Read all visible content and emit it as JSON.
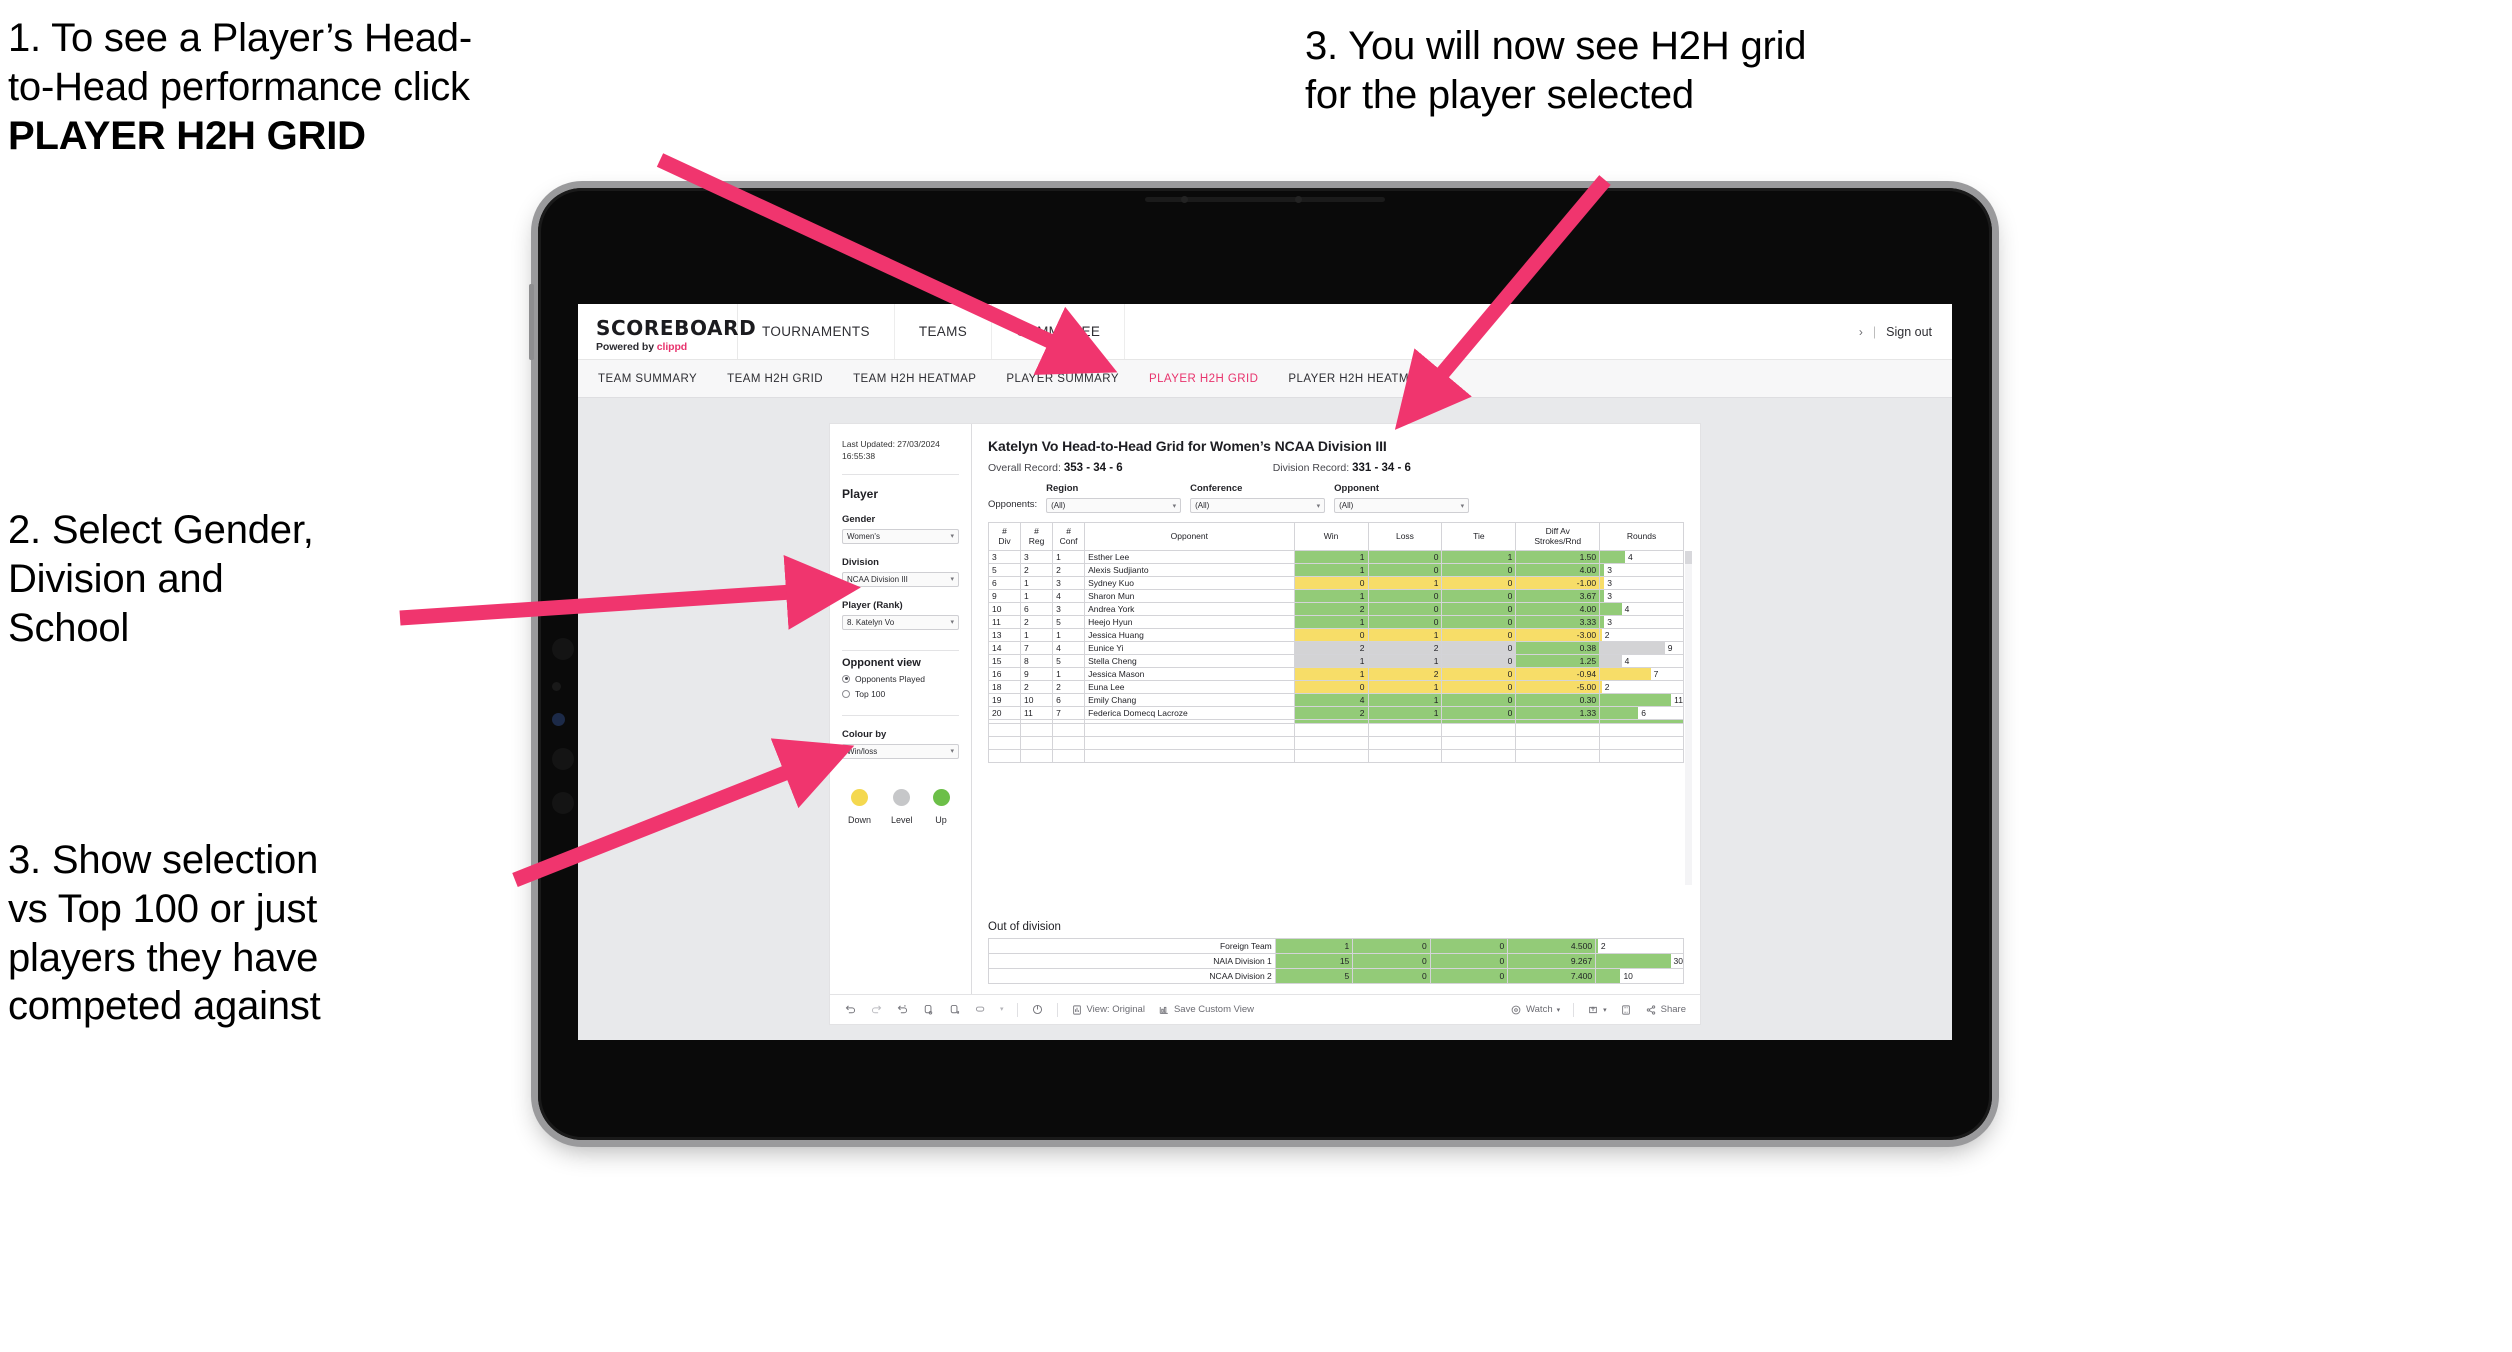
{
  "annotations": [
    {
      "id": "anno1",
      "line1": "1. To see a Player’s Head-",
      "line2": "to-Head performance click",
      "line3": "PLAYER H2H GRID"
    },
    {
      "id": "anno2",
      "text": "2. Select Gender,\nDivision and\nSchool"
    },
    {
      "id": "anno3",
      "text": "3. Show selection\nvs Top 100 or just\nplayers they have\ncompeted against"
    },
    {
      "id": "anno4",
      "text": "3. You will now see H2H grid\nfor the player selected"
    }
  ],
  "accent": {
    "pink": "#e8336d",
    "arrow": "#f0356e",
    "green": "#93cb78",
    "yellow": "#f7dd68",
    "grey": "#d3d3d5"
  },
  "app": {
    "brand": {
      "name": "SCOREBOARD",
      "powered_prefix": "Powered by ",
      "powered_brand": "clippd"
    },
    "mainnav": [
      {
        "label": "TOURNAMENTS"
      },
      {
        "label": "TEAMS"
      },
      {
        "label": "COMMITTEE"
      }
    ],
    "account": {
      "chevron": "›",
      "divider": "|",
      "signout": "Sign out"
    },
    "subnav": [
      {
        "label": "TEAM SUMMARY",
        "active": false
      },
      {
        "label": "TEAM H2H GRID",
        "active": false
      },
      {
        "label": "TEAM H2H HEATMAP",
        "active": false
      },
      {
        "label": "PLAYER SUMMARY",
        "active": false
      },
      {
        "label": "PLAYER H2H GRID",
        "active": true
      },
      {
        "label": "PLAYER H2H HEATMAP",
        "active": false
      }
    ]
  },
  "panel": {
    "last_updated": "Last Updated: 27/03/2024 16:55:38",
    "player_heading": "Player",
    "gender": {
      "label": "Gender",
      "value": "Women's"
    },
    "division": {
      "label": "Division",
      "value": "NCAA Division III"
    },
    "player_rank": {
      "label": "Player (Rank)",
      "value": "8. Katelyn Vo"
    },
    "opponent_view": {
      "heading": "Opponent view",
      "options": [
        {
          "label": "Opponents Played",
          "selected": true
        },
        {
          "label": "Top 100",
          "selected": false
        }
      ]
    },
    "colour_by": {
      "label": "Colour by",
      "value": "Win/loss"
    },
    "legend": [
      {
        "label": "Down",
        "color": "#f4d84f"
      },
      {
        "label": "Level",
        "color": "#c6c7c9"
      },
      {
        "label": "Up",
        "color": "#6cbf48"
      }
    ]
  },
  "viz": {
    "title": "Katelyn Vo Head-to-Head Grid for Women’s NCAA Division III",
    "overall_record_label": "Overall Record: ",
    "overall_record_value": "353 - 34 - 6",
    "division_record_label": "Division Record: ",
    "division_record_value": "331 - 34 - 6",
    "opponents_label": "Opponents:",
    "filters": [
      {
        "caption": "Region",
        "value": "(All)"
      },
      {
        "caption": "Conference",
        "value": "(All)"
      },
      {
        "caption": "Opponent",
        "value": "(All)"
      }
    ]
  },
  "chart_data": {
    "type": "table",
    "title": "Katelyn Vo Head-to-Head Grid for Women’s NCAA Division III",
    "columns": [
      "# Div",
      "# Reg",
      "# Conf",
      "Opponent",
      "Win",
      "Loss",
      "Tie",
      "Diff Av Strokes/Rnd",
      "Rounds"
    ],
    "column_headers_two_line": [
      {
        "top": "#",
        "bottom": "Div"
      },
      {
        "top": "#",
        "bottom": "Reg"
      },
      {
        "top": "#",
        "bottom": "Conf"
      },
      {
        "top": "",
        "bottom": "Opponent"
      },
      {
        "top": "",
        "bottom": "Win"
      },
      {
        "top": "",
        "bottom": "Loss"
      },
      {
        "top": "",
        "bottom": "Tie"
      },
      {
        "top": "Diff Av",
        "bottom": "Strokes/Rnd"
      },
      {
        "top": "",
        "bottom": "Rounds"
      }
    ],
    "rows": [
      {
        "div": "3",
        "reg": "3",
        "conf": "1",
        "opponent": "Esther Lee",
        "win": "1",
        "loss": "0",
        "tie": "1",
        "diff": "1.50",
        "rounds": "4",
        "rounds_pct": 30,
        "color": "green"
      },
      {
        "div": "5",
        "reg": "2",
        "conf": "2",
        "opponent": "Alexis Sudjianto",
        "win": "1",
        "loss": "0",
        "tie": "0",
        "diff": "4.00",
        "rounds": "3",
        "rounds_pct": 5,
        "color": "green"
      },
      {
        "div": "6",
        "reg": "1",
        "conf": "3",
        "opponent": "Sydney Kuo",
        "win": "0",
        "loss": "1",
        "tie": "0",
        "diff": "-1.00",
        "rounds": "3",
        "rounds_pct": 5,
        "color": "yellow"
      },
      {
        "div": "9",
        "reg": "1",
        "conf": "4",
        "opponent": "Sharon Mun",
        "win": "1",
        "loss": "0",
        "tie": "0",
        "diff": "3.67",
        "rounds": "3",
        "rounds_pct": 5,
        "color": "green"
      },
      {
        "div": "10",
        "reg": "6",
        "conf": "3",
        "opponent": "Andrea York",
        "win": "2",
        "loss": "0",
        "tie": "0",
        "diff": "4.00",
        "rounds": "4",
        "rounds_pct": 26,
        "color": "green"
      },
      {
        "div": "11",
        "reg": "2",
        "conf": "5",
        "opponent": "Heejo Hyun",
        "win": "1",
        "loss": "0",
        "tie": "0",
        "diff": "3.33",
        "rounds": "3",
        "rounds_pct": 5,
        "color": "green"
      },
      {
        "div": "13",
        "reg": "1",
        "conf": "1",
        "opponent": "Jessica Huang",
        "win": "0",
        "loss": "1",
        "tie": "0",
        "diff": "-3.00",
        "rounds": "2",
        "rounds_pct": 2,
        "color": "yellow"
      },
      {
        "div": "14",
        "reg": "7",
        "conf": "4",
        "opponent": "Eunice Yi",
        "win": "2",
        "loss": "2",
        "tie": "0",
        "diff": "0.38",
        "rounds": "9",
        "rounds_pct": 78,
        "color": "grey",
        "diff_color": "green"
      },
      {
        "div": "15",
        "reg": "8",
        "conf": "5",
        "opponent": "Stella Cheng",
        "win": "1",
        "loss": "1",
        "tie": "0",
        "diff": "1.25",
        "rounds": "4",
        "rounds_pct": 26,
        "color": "grey",
        "diff_color": "green"
      },
      {
        "div": "16",
        "reg": "9",
        "conf": "1",
        "opponent": "Jessica Mason",
        "win": "1",
        "loss": "2",
        "tie": "0",
        "diff": "-0.94",
        "rounds": "7",
        "rounds_pct": 61,
        "color": "yellow"
      },
      {
        "div": "18",
        "reg": "2",
        "conf": "2",
        "opponent": "Euna Lee",
        "win": "0",
        "loss": "1",
        "tie": "0",
        "diff": "-5.00",
        "rounds": "2",
        "rounds_pct": 2,
        "color": "yellow"
      },
      {
        "div": "19",
        "reg": "10",
        "conf": "6",
        "opponent": "Emily Chang",
        "win": "4",
        "loss": "1",
        "tie": "0",
        "diff": "0.30",
        "rounds": "11",
        "rounds_pct": 92,
        "color": "green"
      },
      {
        "div": "20",
        "reg": "11",
        "conf": "7",
        "opponent": "Federica Domecq Lacroze",
        "win": "2",
        "loss": "1",
        "tie": "0",
        "diff": "1.33",
        "rounds": "6",
        "rounds_pct": 46,
        "color": "green"
      }
    ],
    "out_of_division": {
      "title": "Out of division",
      "rows": [
        {
          "name": "Foreign Team",
          "win": "1",
          "loss": "0",
          "tie": "0",
          "diff": "4.500",
          "rounds": "2",
          "rounds_pct": 2,
          "color": "green"
        },
        {
          "name": "NAIA Division 1",
          "win": "15",
          "loss": "0",
          "tie": "0",
          "diff": "9.267",
          "rounds": "30",
          "rounds_pct": 92,
          "color": "green"
        },
        {
          "name": "NCAA Division 2",
          "win": "5",
          "loss": "0",
          "tie": "0",
          "diff": "7.400",
          "rounds": "10",
          "rounds_pct": 28,
          "color": "green"
        }
      ]
    }
  },
  "toolbar": {
    "items": [
      {
        "name": "undo-icon",
        "label": ""
      },
      {
        "name": "redo-icon",
        "label": ""
      },
      {
        "name": "revert-icon",
        "label": ""
      },
      {
        "name": "refresh-data-icon",
        "label": ""
      },
      {
        "name": "pause-updates-icon",
        "label": ""
      },
      {
        "name": "rectangle-select-icon",
        "label": ""
      },
      {
        "name": "chevron-down-icon",
        "label": ""
      },
      {
        "name": "reset-icon",
        "label": ""
      },
      {
        "name": "view-original-icon",
        "label": "View: Original"
      },
      {
        "name": "save-custom-view-icon",
        "label": "Save Custom View"
      },
      {
        "name": "watch-icon",
        "label": "Watch"
      },
      {
        "name": "watch-chevron-icon",
        "label": ""
      },
      {
        "name": "download-icon",
        "label": ""
      },
      {
        "name": "download-chevron-icon",
        "label": ""
      },
      {
        "name": "fullscreen-icon",
        "label": ""
      },
      {
        "name": "share-icon",
        "label": "Share"
      }
    ]
  }
}
